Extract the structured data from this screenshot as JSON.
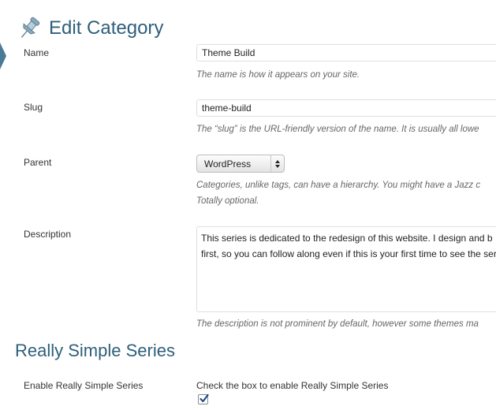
{
  "header": {
    "title": "Edit Category",
    "icon": "pushpin-icon"
  },
  "form": {
    "name": {
      "label": "Name",
      "value": "Theme Build",
      "description": "The name is how it appears on your site."
    },
    "slug": {
      "label": "Slug",
      "value": "theme-build",
      "description": "The “slug” is the URL-friendly version of the name. It is usually all lowe"
    },
    "parent": {
      "label": "Parent",
      "selected": "WordPress",
      "description_line1": "Categories, unlike tags, can have a hierarchy. You might have a Jazz c",
      "description_line2": "Totally optional."
    },
    "description": {
      "label": "Description",
      "value": "This series is dedicated to the redesign of this website. I design and b\nfirst, so you can follow along even if this is your first time to see the ser",
      "description": "The description is not prominent by default, however some themes ma"
    }
  },
  "series": {
    "heading": "Really Simple Series",
    "enable_label": "Enable Really Simple Series",
    "checkbox_text": "Check the box to enable Really Simple Series",
    "checked": true
  },
  "colors": {
    "heading": "#2e5f7a",
    "menu_arrow": "#4b7a97",
    "checkmark": "#1f4e8c"
  }
}
